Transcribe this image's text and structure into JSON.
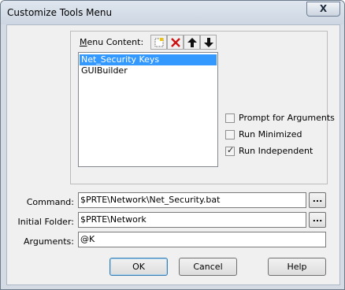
{
  "window": {
    "title": "Customize Tools Menu",
    "close_glyph": "X"
  },
  "menu_content": {
    "label_accel": "M",
    "label_rest": "enu Content:",
    "toolbar": [
      {
        "name": "new-item-icon"
      },
      {
        "name": "delete-icon"
      },
      {
        "name": "move-up-icon"
      },
      {
        "name": "move-down-icon"
      }
    ],
    "items": [
      {
        "label": "Net_Security Keys",
        "selected": true
      },
      {
        "label": "GUIBuilder",
        "selected": false
      }
    ]
  },
  "options": {
    "prompt_for_arguments": {
      "label": "Prompt for  Arguments",
      "checked": false
    },
    "run_minimized": {
      "label": "Run Minimized",
      "checked": false
    },
    "run_independent": {
      "label": "Run Independent",
      "checked": true
    }
  },
  "fields": {
    "command": {
      "label": "Command:",
      "value": "$PRTE\\Network\\Net_Security.bat",
      "browse": "..."
    },
    "initial_folder": {
      "label": "Initial Folder:",
      "value": "$PRTE\\Network",
      "browse": "..."
    },
    "arguments": {
      "label": "Arguments:",
      "value": "@K"
    }
  },
  "buttons": {
    "ok": "OK",
    "cancel": "Cancel",
    "help": "Help"
  },
  "colors": {
    "selection": "#3399ff",
    "delete_icon": "#cc1111"
  }
}
